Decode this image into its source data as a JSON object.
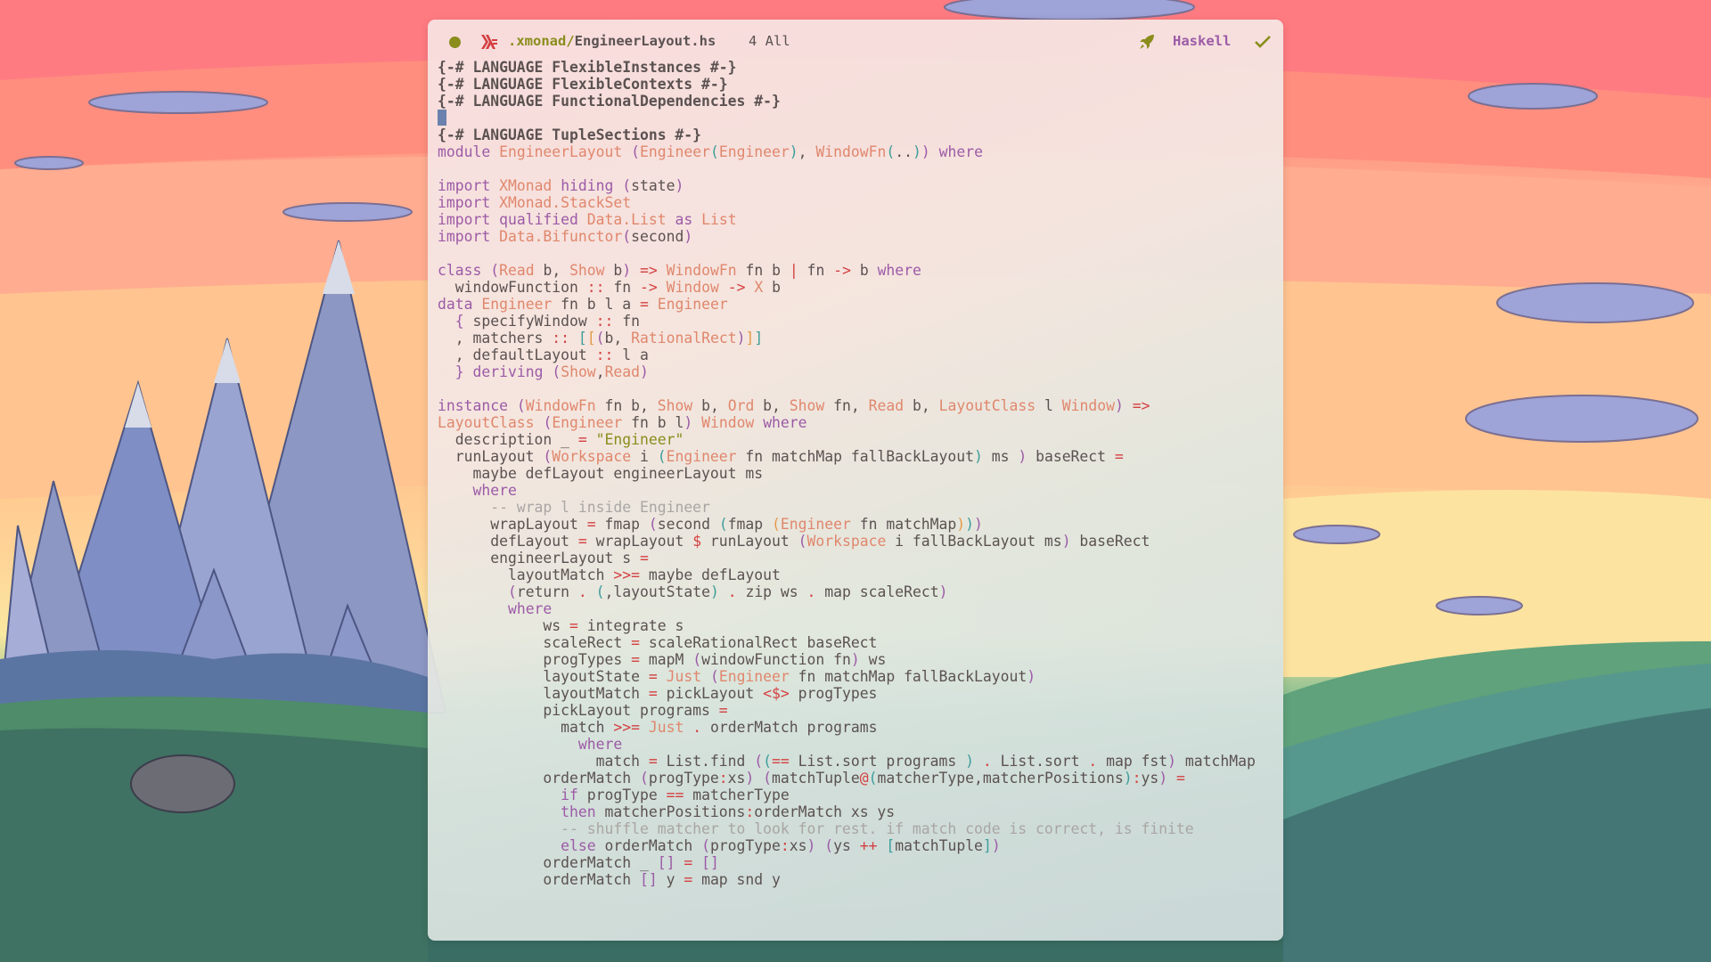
{
  "desktop": {
    "wallpaper": "sunset mountains and green hills illustration"
  },
  "editor": {
    "modeline": {
      "status_dot_color": "#8a8d1c",
      "file_icon": "haskell-logo-icon",
      "path_dir": ".xmonad/",
      "file_name": "EngineerLayout.hs",
      "position": "4 All",
      "mode_icon": "rocket-icon",
      "major_mode": "Haskell",
      "check_icon": "checkmark-icon"
    },
    "colors": {
      "keyword": "#9c5ba7",
      "type": "#e0876d",
      "operator": "#d43f40",
      "string": "#8a8d1c",
      "comment": "#a9a6a4",
      "text": "#5b5251",
      "cursor": "#6a82ad"
    },
    "lines": [
      [
        [
          "prag",
          "{-# LANGUAGE FlexibleInstances #-}"
        ]
      ],
      [
        [
          "prag",
          "{-# LANGUAGE FlexibleContexts #-}"
        ]
      ],
      [
        [
          "prag",
          "{-# LANGUAGE FunctionalDependencies #-}"
        ]
      ],
      [
        [
          "cursor",
          ""
        ]
      ],
      [
        [
          "prag",
          "{-# LANGUAGE TupleSections #-}"
        ]
      ],
      [
        [
          "kw",
          "module"
        ],
        [
          "t",
          " "
        ],
        [
          "ty",
          "EngineerLayout"
        ],
        [
          "t",
          " "
        ],
        [
          "b1",
          "("
        ],
        [
          "ty",
          "Engineer"
        ],
        [
          "b2",
          "("
        ],
        [
          "ty",
          "Engineer"
        ],
        [
          "b2",
          ")"
        ],
        [
          "t",
          ", "
        ],
        [
          "ty",
          "WindowFn"
        ],
        [
          "b2",
          "("
        ],
        [
          "t",
          ".."
        ],
        [
          "b2",
          ")"
        ],
        [
          "b1",
          ")"
        ],
        [
          "t",
          " "
        ],
        [
          "kw",
          "where"
        ]
      ],
      [],
      [
        [
          "kw",
          "import"
        ],
        [
          "t",
          " "
        ],
        [
          "ty",
          "XMonad"
        ],
        [
          "t",
          " "
        ],
        [
          "kw",
          "hiding"
        ],
        [
          "t",
          " "
        ],
        [
          "b1",
          "("
        ],
        [
          "t",
          "state"
        ],
        [
          "b1",
          ")"
        ]
      ],
      [
        [
          "kw",
          "import"
        ],
        [
          "t",
          " "
        ],
        [
          "ty",
          "XMonad.StackSet"
        ]
      ],
      [
        [
          "kw",
          "import"
        ],
        [
          "t",
          " "
        ],
        [
          "kw",
          "qualified"
        ],
        [
          "t",
          " "
        ],
        [
          "ty",
          "Data.List"
        ],
        [
          "t",
          " "
        ],
        [
          "kw",
          "as"
        ],
        [
          "t",
          " "
        ],
        [
          "ty",
          "List"
        ]
      ],
      [
        [
          "kw",
          "import"
        ],
        [
          "t",
          " "
        ],
        [
          "ty",
          "Data.Bifunctor"
        ],
        [
          "b1",
          "("
        ],
        [
          "t",
          "second"
        ],
        [
          "b1",
          ")"
        ]
      ],
      [],
      [
        [
          "kw",
          "class"
        ],
        [
          "t",
          " "
        ],
        [
          "b1",
          "("
        ],
        [
          "ty",
          "Read"
        ],
        [
          "t",
          " b, "
        ],
        [
          "ty",
          "Show"
        ],
        [
          "t",
          " b"
        ],
        [
          "b1",
          ")"
        ],
        [
          "t",
          " "
        ],
        [
          "op",
          "=>"
        ],
        [
          "t",
          " "
        ],
        [
          "ty",
          "WindowFn"
        ],
        [
          "t",
          " fn b "
        ],
        [
          "op",
          "|"
        ],
        [
          "t",
          " fn "
        ],
        [
          "op",
          "->"
        ],
        [
          "t",
          " b "
        ],
        [
          "kw",
          "where"
        ]
      ],
      [
        [
          "t",
          "  windowFunction "
        ],
        [
          "op",
          "::"
        ],
        [
          "t",
          " fn "
        ],
        [
          "op",
          "->"
        ],
        [
          "t",
          " "
        ],
        [
          "ty",
          "Window"
        ],
        [
          "t",
          " "
        ],
        [
          "op",
          "->"
        ],
        [
          "t",
          " "
        ],
        [
          "ty",
          "X"
        ],
        [
          "t",
          " b"
        ]
      ],
      [
        [
          "kw",
          "data"
        ],
        [
          "t",
          " "
        ],
        [
          "ty",
          "Engineer"
        ],
        [
          "t",
          " fn b l a "
        ],
        [
          "op",
          "="
        ],
        [
          "t",
          " "
        ],
        [
          "ty",
          "Engineer"
        ]
      ],
      [
        [
          "t",
          "  "
        ],
        [
          "b1",
          "{"
        ],
        [
          "t",
          " specifyWindow "
        ],
        [
          "op",
          "::"
        ],
        [
          "t",
          " fn"
        ]
      ],
      [
        [
          "t",
          "  , matchers "
        ],
        [
          "op",
          "::"
        ],
        [
          "t",
          " "
        ],
        [
          "b2",
          "["
        ],
        [
          "b3",
          "["
        ],
        [
          "b1",
          "("
        ],
        [
          "t",
          "b, "
        ],
        [
          "ty",
          "RationalRect"
        ],
        [
          "b1",
          ")"
        ],
        [
          "b3",
          "]"
        ],
        [
          "b2",
          "]"
        ]
      ],
      [
        [
          "t",
          "  , defaultLayout "
        ],
        [
          "op",
          "::"
        ],
        [
          "t",
          " l a"
        ]
      ],
      [
        [
          "t",
          "  "
        ],
        [
          "b1",
          "}"
        ],
        [
          "t",
          " "
        ],
        [
          "kw",
          "deriving"
        ],
        [
          "t",
          " "
        ],
        [
          "b1",
          "("
        ],
        [
          "ty",
          "Show"
        ],
        [
          "t",
          ","
        ],
        [
          "ty",
          "Read"
        ],
        [
          "b1",
          ")"
        ]
      ],
      [],
      [
        [
          "kw",
          "instance"
        ],
        [
          "t",
          " "
        ],
        [
          "b1",
          "("
        ],
        [
          "ty",
          "WindowFn"
        ],
        [
          "t",
          " fn b, "
        ],
        [
          "ty",
          "Show"
        ],
        [
          "t",
          " b, "
        ],
        [
          "ty",
          "Ord"
        ],
        [
          "t",
          " b, "
        ],
        [
          "ty",
          "Show"
        ],
        [
          "t",
          " fn, "
        ],
        [
          "ty",
          "Read"
        ],
        [
          "t",
          " b, "
        ],
        [
          "ty",
          "LayoutClass"
        ],
        [
          "t",
          " l "
        ],
        [
          "ty",
          "Window"
        ],
        [
          "b1",
          ")"
        ],
        [
          "t",
          " "
        ],
        [
          "op",
          "=>"
        ]
      ],
      [
        [
          "ty",
          "LayoutClass"
        ],
        [
          "t",
          " "
        ],
        [
          "b1",
          "("
        ],
        [
          "ty",
          "Engineer"
        ],
        [
          "t",
          " fn b l"
        ],
        [
          "b1",
          ")"
        ],
        [
          "t",
          " "
        ],
        [
          "ty",
          "Window"
        ],
        [
          "t",
          " "
        ],
        [
          "kw",
          "where"
        ]
      ],
      [
        [
          "t",
          "  description _ "
        ],
        [
          "op",
          "="
        ],
        [
          "t",
          " "
        ],
        [
          "str",
          "\"Engineer\""
        ]
      ],
      [
        [
          "t",
          "  runLayout "
        ],
        [
          "b1",
          "("
        ],
        [
          "ty",
          "Workspace"
        ],
        [
          "t",
          " i "
        ],
        [
          "b2",
          "("
        ],
        [
          "ty",
          "Engineer"
        ],
        [
          "t",
          " fn matchMap fallBackLayout"
        ],
        [
          "b2",
          ")"
        ],
        [
          "t",
          " ms "
        ],
        [
          "b1",
          ")"
        ],
        [
          "t",
          " baseRect "
        ],
        [
          "op",
          "="
        ]
      ],
      [
        [
          "t",
          "    maybe defLayout engineerLayout ms"
        ]
      ],
      [
        [
          "t",
          "    "
        ],
        [
          "kw",
          "where"
        ]
      ],
      [
        [
          "t",
          "      "
        ],
        [
          "cm",
          "-- wrap l inside Engineer"
        ]
      ],
      [
        [
          "t",
          "      wrapLayout "
        ],
        [
          "op",
          "="
        ],
        [
          "t",
          " fmap "
        ],
        [
          "b1",
          "("
        ],
        [
          "t",
          "second "
        ],
        [
          "b2",
          "("
        ],
        [
          "t",
          "fmap "
        ],
        [
          "b3",
          "("
        ],
        [
          "ty",
          "Engineer"
        ],
        [
          "t",
          " fn matchMap"
        ],
        [
          "b3",
          ")"
        ],
        [
          "b2",
          ")"
        ],
        [
          "b1",
          ")"
        ]
      ],
      [
        [
          "t",
          "      defLayout "
        ],
        [
          "op",
          "="
        ],
        [
          "t",
          " wrapLayout "
        ],
        [
          "op",
          "$"
        ],
        [
          "t",
          " runLayout "
        ],
        [
          "b1",
          "("
        ],
        [
          "ty",
          "Workspace"
        ],
        [
          "t",
          " i fallBackLayout ms"
        ],
        [
          "b1",
          ")"
        ],
        [
          "t",
          " baseRect"
        ]
      ],
      [
        [
          "t",
          "      engineerLayout s "
        ],
        [
          "op",
          "="
        ]
      ],
      [
        [
          "t",
          "        layoutMatch "
        ],
        [
          "op",
          ">>="
        ],
        [
          "t",
          " maybe defLayout"
        ]
      ],
      [
        [
          "t",
          "        "
        ],
        [
          "b1",
          "("
        ],
        [
          "t",
          "return "
        ],
        [
          "op",
          "."
        ],
        [
          "t",
          " "
        ],
        [
          "b2",
          "("
        ],
        [
          "t",
          ",layoutState"
        ],
        [
          "b2",
          ")"
        ],
        [
          "t",
          " "
        ],
        [
          "op",
          "."
        ],
        [
          "t",
          " zip ws "
        ],
        [
          "op",
          "."
        ],
        [
          "t",
          " map scaleRect"
        ],
        [
          "b1",
          ")"
        ]
      ],
      [
        [
          "t",
          "        "
        ],
        [
          "kw",
          "where"
        ]
      ],
      [
        [
          "t",
          "            ws "
        ],
        [
          "op",
          "="
        ],
        [
          "t",
          " integrate s"
        ]
      ],
      [
        [
          "t",
          "            scaleRect "
        ],
        [
          "op",
          "="
        ],
        [
          "t",
          " scaleRationalRect baseRect"
        ]
      ],
      [
        [
          "t",
          "            progTypes "
        ],
        [
          "op",
          "="
        ],
        [
          "t",
          " mapM "
        ],
        [
          "b1",
          "("
        ],
        [
          "t",
          "windowFunction fn"
        ],
        [
          "b1",
          ")"
        ],
        [
          "t",
          " ws"
        ]
      ],
      [
        [
          "t",
          "            layoutState "
        ],
        [
          "op",
          "="
        ],
        [
          "t",
          " "
        ],
        [
          "ty",
          "Just"
        ],
        [
          "t",
          " "
        ],
        [
          "b1",
          "("
        ],
        [
          "ty",
          "Engineer"
        ],
        [
          "t",
          " fn matchMap fallBackLayout"
        ],
        [
          "b1",
          ")"
        ]
      ],
      [
        [
          "t",
          "            layoutMatch "
        ],
        [
          "op",
          "="
        ],
        [
          "t",
          " pickLayout "
        ],
        [
          "op",
          "<$>"
        ],
        [
          "t",
          " progTypes"
        ]
      ],
      [
        [
          "t",
          "            pickLayout programs "
        ],
        [
          "op",
          "="
        ]
      ],
      [
        [
          "t",
          "              match "
        ],
        [
          "op",
          ">>="
        ],
        [
          "t",
          " "
        ],
        [
          "ty",
          "Just"
        ],
        [
          "t",
          " "
        ],
        [
          "op",
          "."
        ],
        [
          "t",
          " orderMatch programs"
        ]
      ],
      [
        [
          "t",
          "                "
        ],
        [
          "kw",
          "where"
        ]
      ],
      [
        [
          "t",
          "                  match "
        ],
        [
          "op",
          "="
        ],
        [
          "t",
          " List.find "
        ],
        [
          "b1",
          "("
        ],
        [
          "b2",
          "("
        ],
        [
          "op",
          "=="
        ],
        [
          "t",
          " List.sort programs "
        ],
        [
          "b2",
          ")"
        ],
        [
          "t",
          " "
        ],
        [
          "op",
          "."
        ],
        [
          "t",
          " List.sort "
        ],
        [
          "op",
          "."
        ],
        [
          "t",
          " map fst"
        ],
        [
          "b1",
          ")"
        ],
        [
          "t",
          " matchMap"
        ]
      ],
      [
        [
          "t",
          "            orderMatch "
        ],
        [
          "b1",
          "("
        ],
        [
          "t",
          "progType"
        ],
        [
          "op",
          ":"
        ],
        [
          "t",
          "xs"
        ],
        [
          "b1",
          ")"
        ],
        [
          "t",
          " "
        ],
        [
          "b1",
          "("
        ],
        [
          "t",
          "matchTuple"
        ],
        [
          "op",
          "@"
        ],
        [
          "b2",
          "("
        ],
        [
          "t",
          "matcherType,matcherPositions"
        ],
        [
          "b2",
          ")"
        ],
        [
          "op",
          ":"
        ],
        [
          "t",
          "ys"
        ],
        [
          "b1",
          ")"
        ],
        [
          "t",
          " "
        ],
        [
          "op",
          "="
        ]
      ],
      [
        [
          "t",
          "              "
        ],
        [
          "kw",
          "if"
        ],
        [
          "t",
          " progType "
        ],
        [
          "op",
          "=="
        ],
        [
          "t",
          " matcherType"
        ]
      ],
      [
        [
          "t",
          "              "
        ],
        [
          "kw",
          "then"
        ],
        [
          "t",
          " matcherPositions"
        ],
        [
          "op",
          ":"
        ],
        [
          "t",
          "orderMatch xs ys"
        ]
      ],
      [
        [
          "t",
          "              "
        ],
        [
          "cm",
          "-- shuffle matcher to look for rest. if match code is correct, is finite"
        ]
      ],
      [
        [
          "t",
          "              "
        ],
        [
          "kw",
          "else"
        ],
        [
          "t",
          " orderMatch "
        ],
        [
          "b1",
          "("
        ],
        [
          "t",
          "progType"
        ],
        [
          "op",
          ":"
        ],
        [
          "t",
          "xs"
        ],
        [
          "b1",
          ")"
        ],
        [
          "t",
          " "
        ],
        [
          "b1",
          "("
        ],
        [
          "t",
          "ys "
        ],
        [
          "op",
          "++"
        ],
        [
          "t",
          " "
        ],
        [
          "b2",
          "["
        ],
        [
          "t",
          "matchTuple"
        ],
        [
          "b2",
          "]"
        ],
        [
          "b1",
          ")"
        ]
      ],
      [
        [
          "t",
          "            orderMatch _ "
        ],
        [
          "b1",
          "[]"
        ],
        [
          "t",
          " "
        ],
        [
          "op",
          "="
        ],
        [
          "t",
          " "
        ],
        [
          "b1",
          "[]"
        ]
      ],
      [
        [
          "t",
          "            orderMatch "
        ],
        [
          "b1",
          "[]"
        ],
        [
          "t",
          " y "
        ],
        [
          "op",
          "="
        ],
        [
          "t",
          " map snd y"
        ]
      ]
    ]
  }
}
